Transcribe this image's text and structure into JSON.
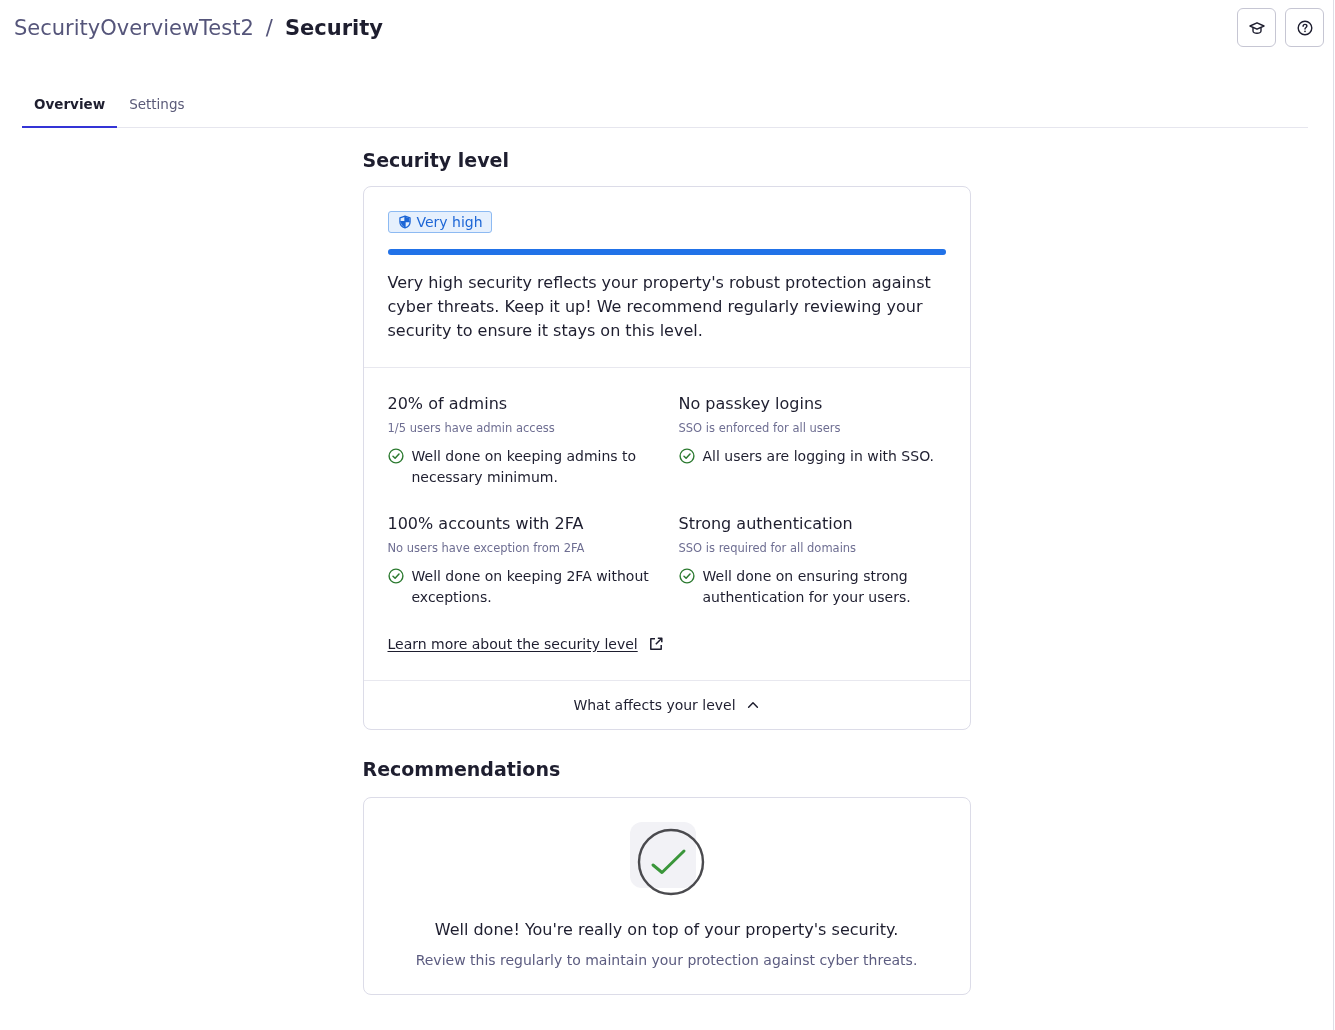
{
  "breadcrumb": {
    "parent": "SecurityOverviewTest2",
    "separator": "/",
    "current": "Security"
  },
  "tabs": [
    {
      "label": "Overview",
      "selected": true
    },
    {
      "label": "Settings",
      "selected": false
    }
  ],
  "security_level": {
    "heading": "Security level",
    "badge": "Very high",
    "level": 1.0,
    "description": "Very high security reflects your property's robust protection against cyber threats. Keep it up! We recommend regularly reviewing your security to ensure it stays on this level.",
    "metrics": [
      {
        "title": "20% of admins",
        "subtitle": "1/5 users have admin access",
        "status_text": "Well done on keeping admins to necessary minimum.",
        "passed": true
      },
      {
        "title": "No passkey logins",
        "subtitle": "SSO is enforced for all users",
        "status_text": "All users are logging in with SSO.",
        "passed": true
      },
      {
        "title": "100% accounts with 2FA",
        "subtitle": "No users have exception from 2FA",
        "status_text": "Well done on keeping 2FA without exceptions.",
        "passed": true
      },
      {
        "title": "Strong authentication",
        "subtitle": "SSO is required for all domains",
        "status_text": "Well done on ensuring strong authentication for your users.",
        "passed": true
      }
    ],
    "link": "Learn more about the security level",
    "toggle": {
      "label": "What affects your level",
      "expanded": true
    }
  },
  "recommendations": {
    "heading": "Recommendations",
    "title": "Well done! You're really on top of your property's security.",
    "subtitle": "Review this regularly to maintain your protection against cyber threats."
  }
}
